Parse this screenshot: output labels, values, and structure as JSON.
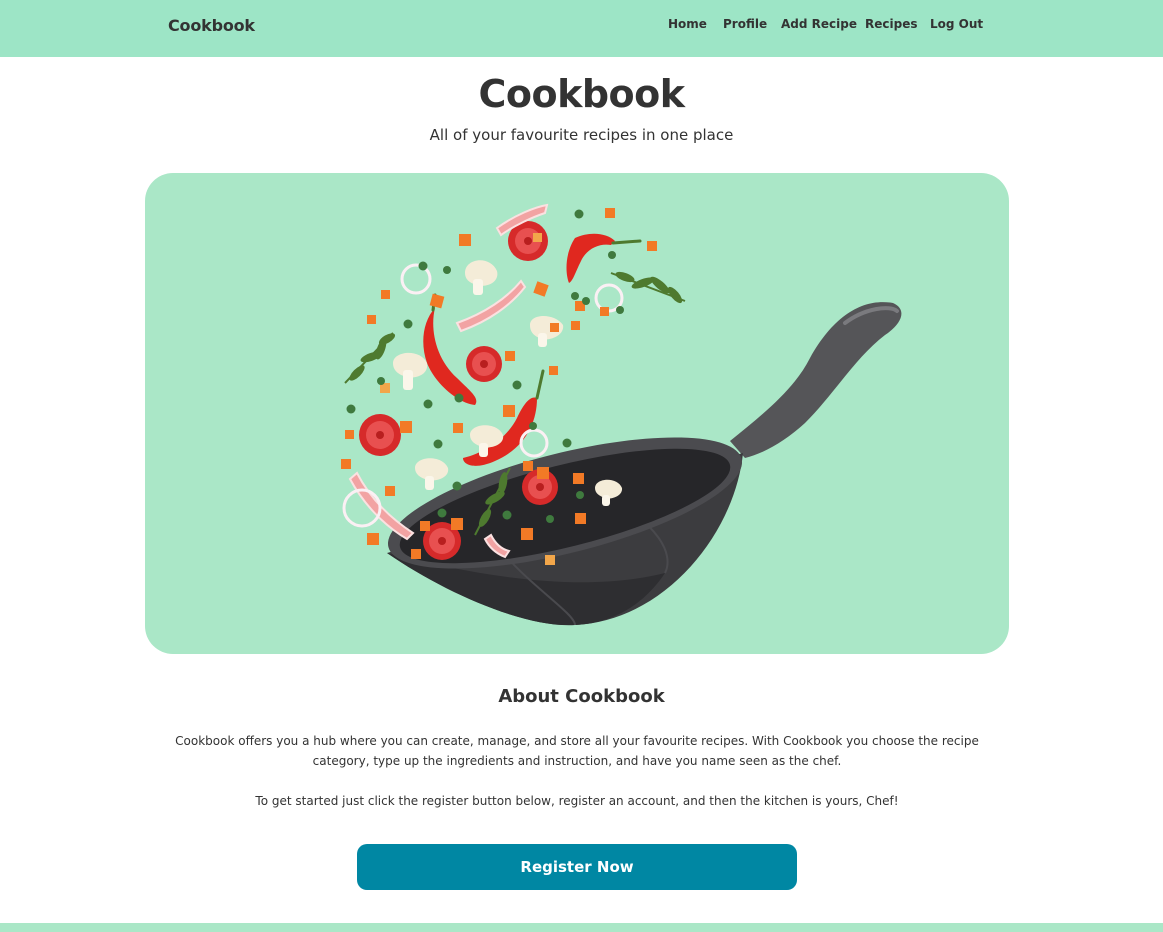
{
  "navbar": {
    "brand": "Cookbook",
    "links": [
      {
        "label": "Home"
      },
      {
        "label": "Profile"
      },
      {
        "label": "Add Recipe"
      },
      {
        "label": "Recipes"
      },
      {
        "label": "Log Out"
      }
    ]
  },
  "hero": {
    "title": "Cookbook",
    "subtitle": "All of your favourite recipes in one place"
  },
  "about": {
    "title": "About Cookbook",
    "paragraph1": "Cookbook offers you a hub where you can create, manage, and store all your favourite recipes. With Cookbook you choose the recipe category, type up the ingredients and instruction, and have you name seen as the chef.",
    "paragraph2": "To get started just click the register button below, register an account, and then the kitchen is yours, Chef!"
  },
  "cta": {
    "label": "Register Now"
  },
  "colors": {
    "navbar_bg": "#9de5c6",
    "hero_bg": "#aae7c7",
    "button_bg": "#0087a3",
    "text": "#333333"
  }
}
